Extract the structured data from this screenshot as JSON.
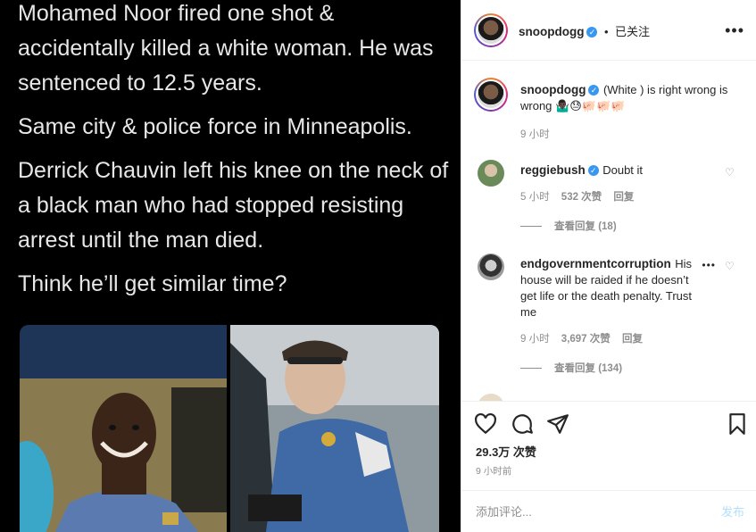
{
  "tweet": {
    "paragraphs": [
      "Mohamed Noor fired one shot & accidentally killed a white woman. He was sentenced to 12.5 years.",
      "Same city & police force in Minneapolis.",
      "Derrick Chauvin left his knee on the neck of a black man who had stopped resisting arrest until the man died.",
      "Think he’ll get similar time?"
    ]
  },
  "header": {
    "username": "snoopdogg",
    "separator": "•",
    "follow_status": "已关注",
    "more_icon": "more-horizontal-icon"
  },
  "caption": {
    "username": "snoopdogg",
    "text": "(White ) is right wrong is wrong 🤷🏿‍♂️😓🐖🐖🐖",
    "time": "9 小时"
  },
  "comments": [
    {
      "username": "reggiebush",
      "text": "Doubt it",
      "time": "5 小时",
      "likes": "532 次赞",
      "reply": "回复",
      "view_replies": "查看回复 (18)"
    },
    {
      "username": "endgovernmentcorruption",
      "text": "His house will be raided if he doesn’t get life or the death penalty. Trust me",
      "time": "9 小时",
      "likes": "3,697 次赞",
      "reply": "回复",
      "view_replies": "查看回复 (134)"
    }
  ],
  "actions": {
    "like_icon": "heart-icon",
    "comment_icon": "comment-icon",
    "share_icon": "paper-plane-icon",
    "save_icon": "bookmark-icon",
    "likes_count": "29.3万 次赞",
    "time_ago": "9 小时前"
  },
  "comment_box": {
    "placeholder": "添加评论...",
    "post_label": "发布"
  },
  "colors": {
    "verified": "#3897f0",
    "muted": "#8e8e8e",
    "post_disabled": "#b2dffc",
    "border": "#efefef"
  }
}
